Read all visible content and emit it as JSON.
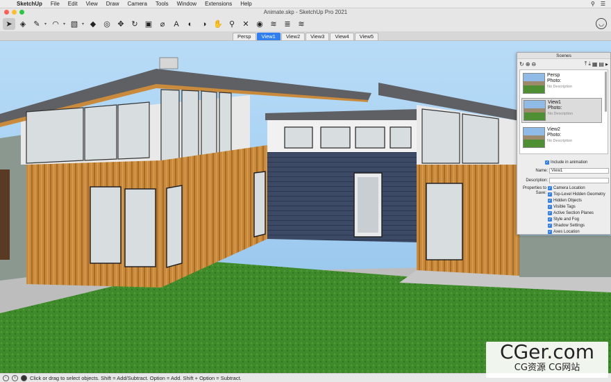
{
  "menubar": {
    "app_name": "SketchUp",
    "items": [
      "File",
      "Edit",
      "View",
      "Draw",
      "Camera",
      "Tools",
      "Window",
      "Extensions",
      "Help"
    ]
  },
  "window": {
    "title": "Animate.skp - SketchUp Pro 2021"
  },
  "toolbar": {
    "tools": [
      {
        "name": "select-tool",
        "icon": "arrow-icon",
        "glyph": "➤"
      },
      {
        "name": "eraser-tool",
        "icon": "eraser-icon",
        "glyph": "◈"
      },
      {
        "name": "line-tool",
        "icon": "pencil-icon",
        "glyph": "✎"
      },
      {
        "name": "arc-tool",
        "icon": "arc-icon",
        "glyph": "◠"
      },
      {
        "name": "rectangle-tool",
        "icon": "rectangle-icon",
        "glyph": "▧"
      },
      {
        "name": "push-pull-tool",
        "icon": "push-pull-icon",
        "glyph": "◆"
      },
      {
        "name": "offset-tool",
        "icon": "offset-icon",
        "glyph": "◎"
      },
      {
        "name": "move-tool",
        "icon": "move-icon",
        "glyph": "✥"
      },
      {
        "name": "rotate-tool",
        "icon": "rotate-icon",
        "glyph": "↻"
      },
      {
        "name": "scale-tool",
        "icon": "scale-icon",
        "glyph": "▣"
      },
      {
        "name": "tape-measure-tool",
        "icon": "tape-measure-icon",
        "glyph": "⌀"
      },
      {
        "name": "text-tool",
        "icon": "text-icon",
        "glyph": "A"
      },
      {
        "name": "paint-bucket-tool",
        "icon": "paint-bucket-icon",
        "glyph": "◐"
      },
      {
        "name": "orbit-tool",
        "icon": "orbit-icon",
        "glyph": "◑"
      },
      {
        "name": "pan-tool",
        "icon": "pan-icon",
        "glyph": "✋"
      },
      {
        "name": "zoom-tool",
        "icon": "zoom-icon",
        "glyph": "⚲"
      },
      {
        "name": "zoom-extents-tool",
        "icon": "zoom-extents-icon",
        "glyph": "✕"
      },
      {
        "name": "warehouse-tool",
        "icon": "warehouse-icon",
        "glyph": "◉"
      },
      {
        "name": "extension-warehouse-tool",
        "icon": "extension-warehouse-icon",
        "glyph": "≋"
      },
      {
        "name": "layout-tool",
        "icon": "layout-icon",
        "glyph": "≣"
      },
      {
        "name": "style-builder-tool",
        "icon": "style-builder-icon",
        "glyph": "≋"
      }
    ]
  },
  "scene_tabs": [
    "Persp",
    "View1",
    "View2",
    "View3",
    "View4",
    "View5"
  ],
  "scene_tabs_selected": "View1",
  "scenes_panel": {
    "title": "Scenes",
    "scenes": [
      {
        "name": "Persp",
        "photo": "Photo:",
        "description": "No Description"
      },
      {
        "name": "View1",
        "photo": "Photo:",
        "description": "No Description"
      },
      {
        "name": "View2",
        "photo": "Photo:",
        "description": "No Description"
      }
    ],
    "include_in_animation": "Include in animation",
    "name_label": "Name:",
    "name_value": "View1",
    "description_label": "Description:",
    "description_value": "",
    "properties_label": "Properties to Save:",
    "properties": [
      "Camera Location",
      "Top-Level Hidden Geometry",
      "Hidden Objects",
      "Visible Tags",
      "Active Section Planes",
      "Style and Fog",
      "Shadow Settings",
      "Axes Location"
    ]
  },
  "statusbar": {
    "message": "Click or drag to select objects. Shift = Add/Subtract. Option = Add. Shift + Option = Subtract."
  },
  "watermark": {
    "big": "CGer.com",
    "small": "CG资源  CG网站"
  },
  "colors": {
    "selection_blue": "#2f7ff2",
    "sky": "#9ec9ef",
    "grass": "#3f8a2a",
    "siding_wood": "#c98a3b",
    "siding_navy": "#3c4a66"
  }
}
